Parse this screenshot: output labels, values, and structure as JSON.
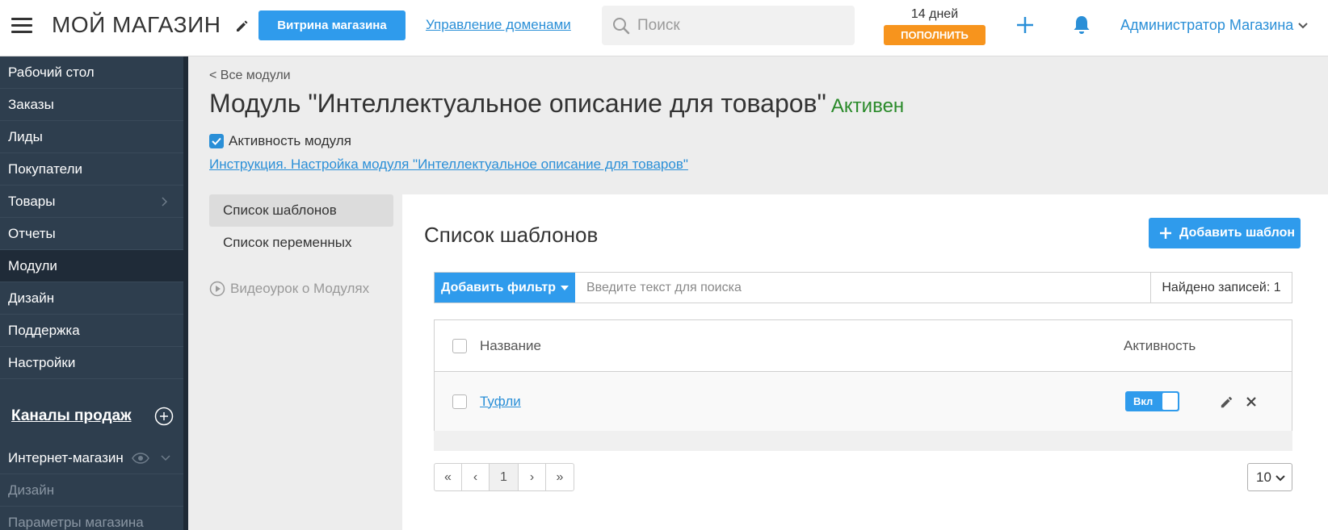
{
  "header": {
    "logo": "МОЙ МАГАЗИН",
    "storefront_button": "Витрина магазина",
    "domains_link": "Управление доменами",
    "search_placeholder": "Поиск",
    "days_left": "14 дней",
    "topup_button": "ПОПОЛНИТЬ",
    "admin_name": "Администратор Магазина"
  },
  "sidebar": {
    "items": [
      {
        "label": "Рабочий стол"
      },
      {
        "label": "Заказы"
      },
      {
        "label": "Лиды"
      },
      {
        "label": "Покупатели"
      },
      {
        "label": "Товары"
      },
      {
        "label": "Отчеты"
      },
      {
        "label": "Модули"
      },
      {
        "label": "Дизайн"
      },
      {
        "label": "Поддержка"
      },
      {
        "label": "Настройки"
      }
    ],
    "channels_heading": "Каналы продаж",
    "channels": [
      {
        "label": "Интернет-магазин"
      },
      {
        "label": "Дизайн"
      },
      {
        "label": "Параметры магазина"
      }
    ]
  },
  "main": {
    "breadcrumb": "< Все модули",
    "title": "Модуль \"Интеллектуальное описание для товаров\"",
    "status": "Активен",
    "activity_label": "Активность модуля",
    "instruction_link": "Инструкция. Настройка модуля \"Интеллектуальное описание для товаров\"",
    "left_menu": [
      {
        "label": "Список шаблонов"
      },
      {
        "label": "Список переменных"
      }
    ],
    "video_link": "Видеоурок о Модулях"
  },
  "panel": {
    "title": "Список шаблонов",
    "add_button": "Добавить шаблон",
    "filter_button": "Добавить фильтр",
    "filter_placeholder": "Введите текст для поиска",
    "found": "Найдено записей: 1",
    "columns": {
      "name": "Название",
      "active": "Активность"
    },
    "rows": [
      {
        "name": "Туфли",
        "toggle": "Вкл"
      }
    ],
    "pager": [
      "«",
      "‹",
      "1",
      "›",
      "»"
    ],
    "page_size": "10"
  },
  "colors": {
    "accent": "#2f9bec",
    "topup": "#f7941d",
    "status_active": "#2a8a2a",
    "sidebar_bg": "#2e3e4e"
  }
}
